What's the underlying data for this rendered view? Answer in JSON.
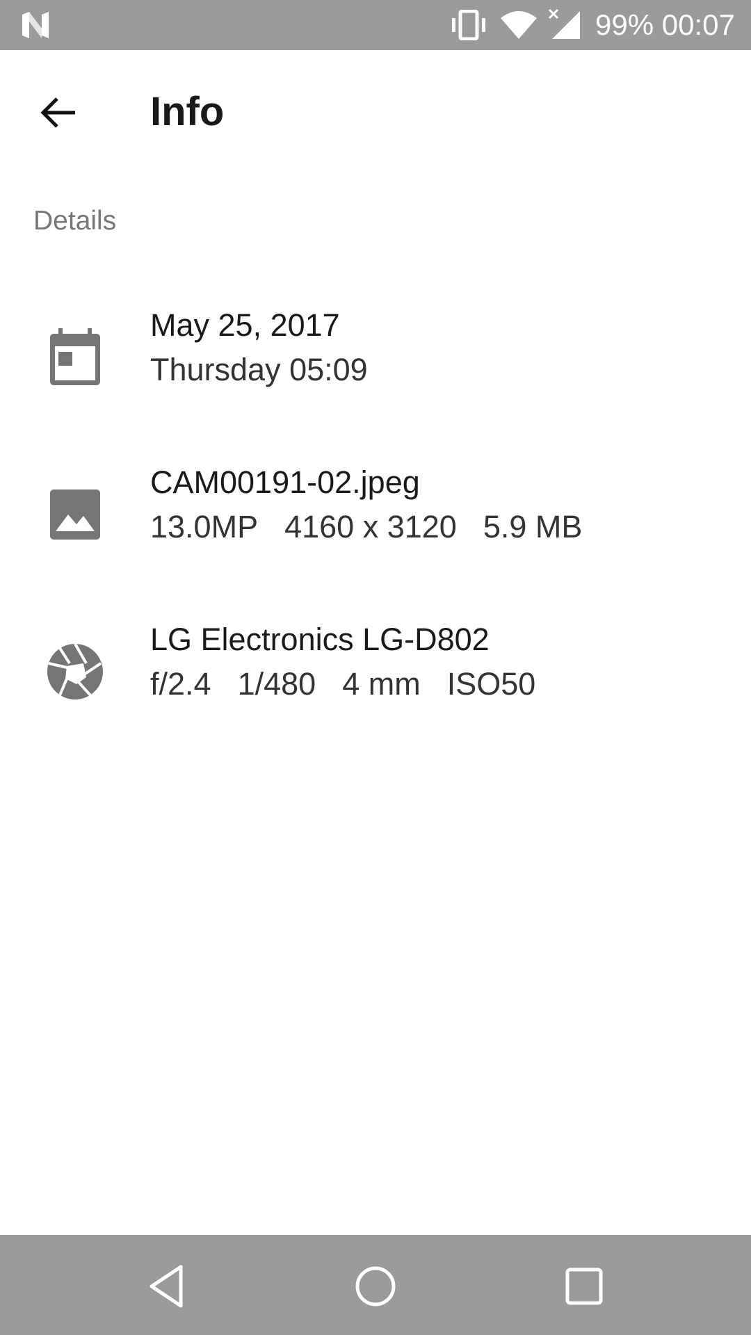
{
  "status_bar": {
    "battery": "99%",
    "time": "00:07",
    "icons": [
      "n-logo-icon",
      "vibrate-icon",
      "wifi-icon",
      "signal-icon"
    ]
  },
  "app_bar": {
    "title": "Info",
    "back_icon": "arrow-back-icon"
  },
  "section": {
    "header": "Details"
  },
  "details": [
    {
      "icon": "calendar-icon",
      "primary": "May 25, 2017",
      "secondary": [
        "Thursday 05:09"
      ]
    },
    {
      "icon": "image-icon",
      "primary": "CAM00191-02.jpeg",
      "secondary": [
        "13.0MP",
        "4160 x 3120",
        "5.9 MB"
      ]
    },
    {
      "icon": "camera-iris-icon",
      "primary": "LG Electronics LG-D802",
      "secondary": [
        "f/2.4",
        "1/480",
        "4 mm",
        "ISO50"
      ]
    }
  ],
  "nav_bar": {
    "icons": [
      "nav-back-icon",
      "nav-home-icon",
      "nav-recents-icon"
    ]
  },
  "colors": {
    "system_bar": "#9a9a9a",
    "icon_gray": "#757575",
    "text_primary": "#1a1a1a",
    "section_header": "#777777"
  }
}
